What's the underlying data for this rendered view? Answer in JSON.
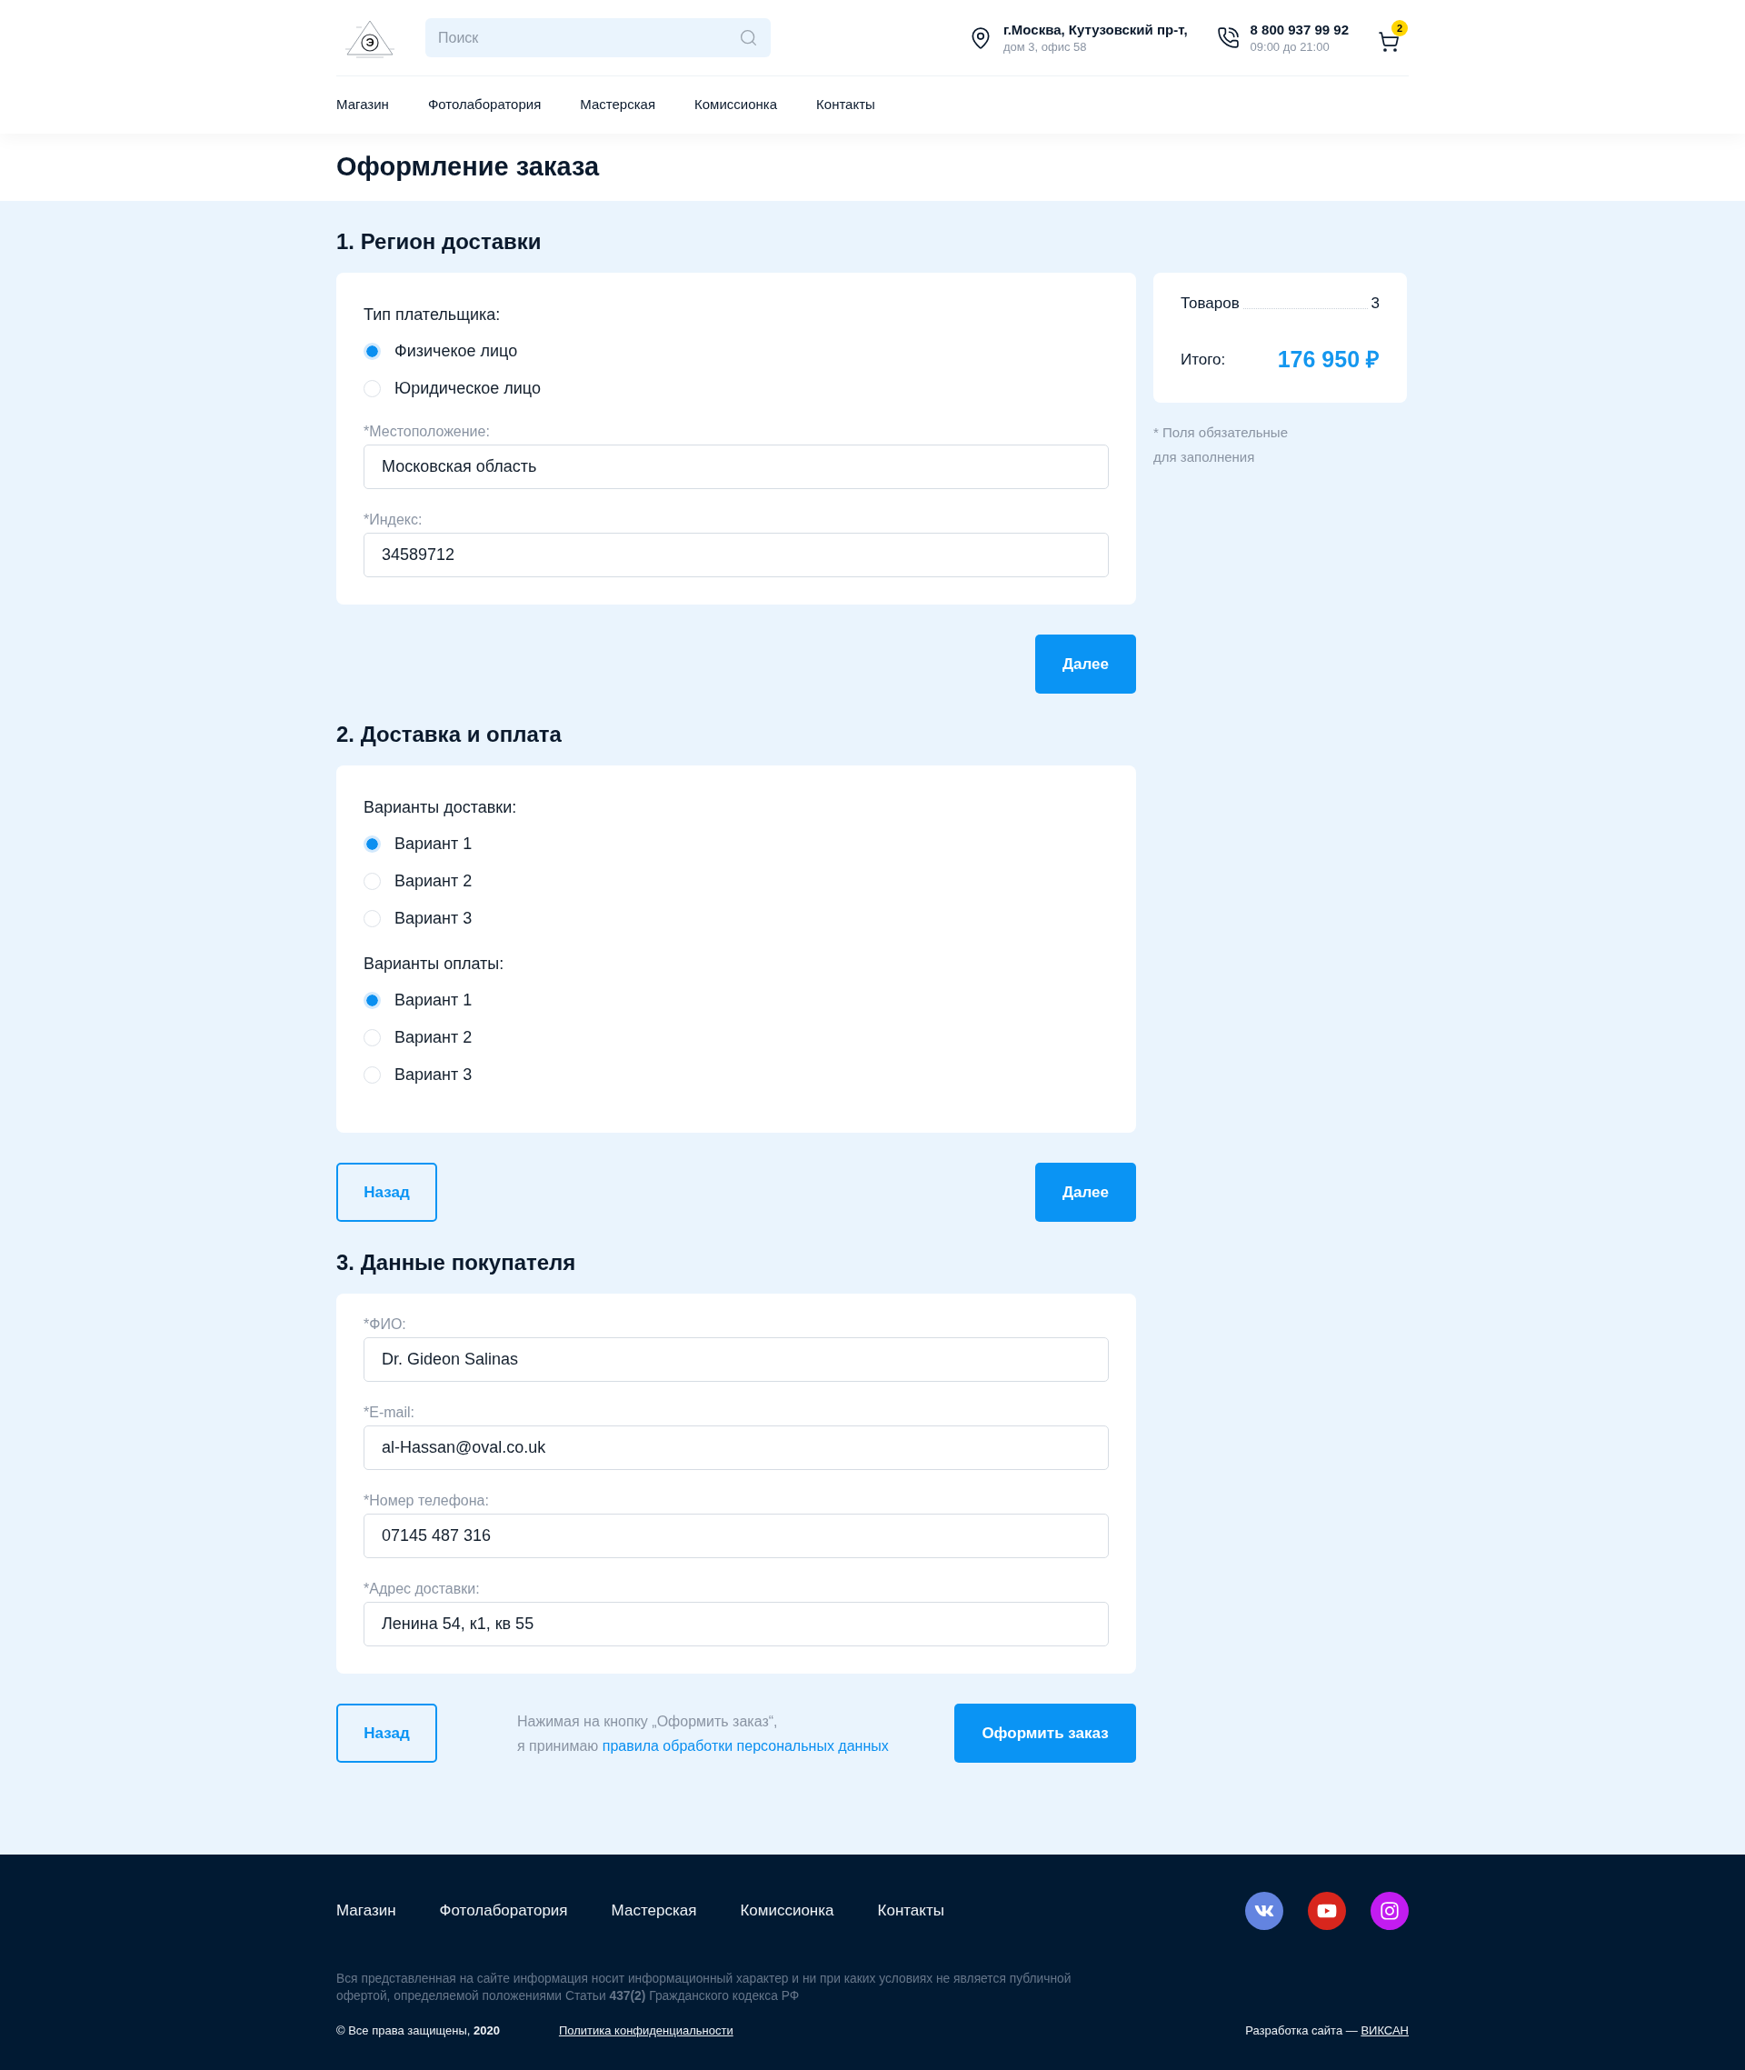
{
  "header": {
    "logo": {
      "letter": "Э"
    },
    "search": {
      "placeholder": "Поиск"
    },
    "address": {
      "line1": "г.Москва, Кутузовский пр-т,",
      "line2": "дом 3, офис 58"
    },
    "phone": {
      "number": "8 800 937 99 92",
      "hours": "09:00 до 21:00"
    },
    "cart": {
      "count": "2"
    },
    "nav": [
      {
        "label": "Магазин"
      },
      {
        "label": "Фотолаборатория"
      },
      {
        "label": "Мастерская"
      },
      {
        "label": "Комиссионка"
      },
      {
        "label": "Контакты"
      }
    ]
  },
  "page_title": "Оформление заказа",
  "sections": [
    {
      "title": "1. Регион доставки",
      "items": [
        {
          "kind": "radio",
          "label": "Тип плательщика:",
          "options": [
            {
              "label": "Физичекое лицо",
              "selected": true
            },
            {
              "label": "Юридическое лицо",
              "selected": false
            }
          ]
        },
        {
          "kind": "field",
          "label": "*Местоположение:",
          "value": "Московская область"
        },
        {
          "kind": "field",
          "label": "*Индекс:",
          "value": "34589712"
        }
      ],
      "actions": [
        {
          "kind": "next",
          "label": "Далее"
        }
      ]
    },
    {
      "title": "2. Доставка и оплата",
      "items": [
        {
          "kind": "radio",
          "label": "Варианты доставки:",
          "options": [
            {
              "label": "Вариант 1",
              "selected": true
            },
            {
              "label": "Вариант 2",
              "selected": false
            },
            {
              "label": "Вариант 3",
              "selected": false
            }
          ]
        },
        {
          "kind": "radio",
          "label": "Варианты оплаты:",
          "options": [
            {
              "label": "Вариант 1",
              "selected": true
            },
            {
              "label": "Вариант 2",
              "selected": false
            },
            {
              "label": "Вариант 3",
              "selected": false
            }
          ]
        }
      ],
      "actions": [
        {
          "kind": "back",
          "label": "Назад"
        },
        {
          "kind": "next",
          "label": "Далее"
        }
      ]
    },
    {
      "title": "3. Данные покупателя",
      "items": [
        {
          "kind": "field",
          "label": "*ФИО:",
          "value": "Dr. Gideon Salinas"
        },
        {
          "kind": "field",
          "label": "*E-mail:",
          "value": "al-Hassan@oval.co.uk"
        },
        {
          "kind": "field",
          "label": "*Номер телефона:",
          "value": "07145 487 316"
        },
        {
          "kind": "field",
          "label": "*Адрес доставки:",
          "value": "Ленина 54, к1, кв 55"
        }
      ],
      "actions": [
        {
          "kind": "back",
          "label": "Назад"
        },
        {
          "kind": "consent",
          "text": "Нажимая на кнопку „Оформить заказ“,",
          "lead": "я принимаю",
          "link": "правила обработки персональных данных"
        },
        {
          "kind": "submit",
          "label": "Оформить заказ"
        }
      ]
    }
  ],
  "summary": {
    "items_label": "Товаров",
    "items_count": "3",
    "total_label": "Итого:",
    "total": "176 950 ₽",
    "note_lines": [
      "* Поля обязательные",
      "для заполнения"
    ]
  },
  "footer": {
    "nav": [
      {
        "label": "Магазин"
      },
      {
        "label": "Фотолаборатория"
      },
      {
        "label": "Мастерская"
      },
      {
        "label": "Комиссионка"
      },
      {
        "label": "Контакты"
      }
    ],
    "disclaimer": "Вся представленная на сайте информация носит информационный характер и ни при каких условиях не является публичной офертой, определяемой положениями Статьи **437(2)** Гражданского кодекса РФ",
    "copyright": "© Все права защищены, **2020**",
    "policy_link": "Политика конфиденциальности",
    "credit_label": "Разработка сайта —",
    "credit_link": "ВИКСАН"
  }
}
